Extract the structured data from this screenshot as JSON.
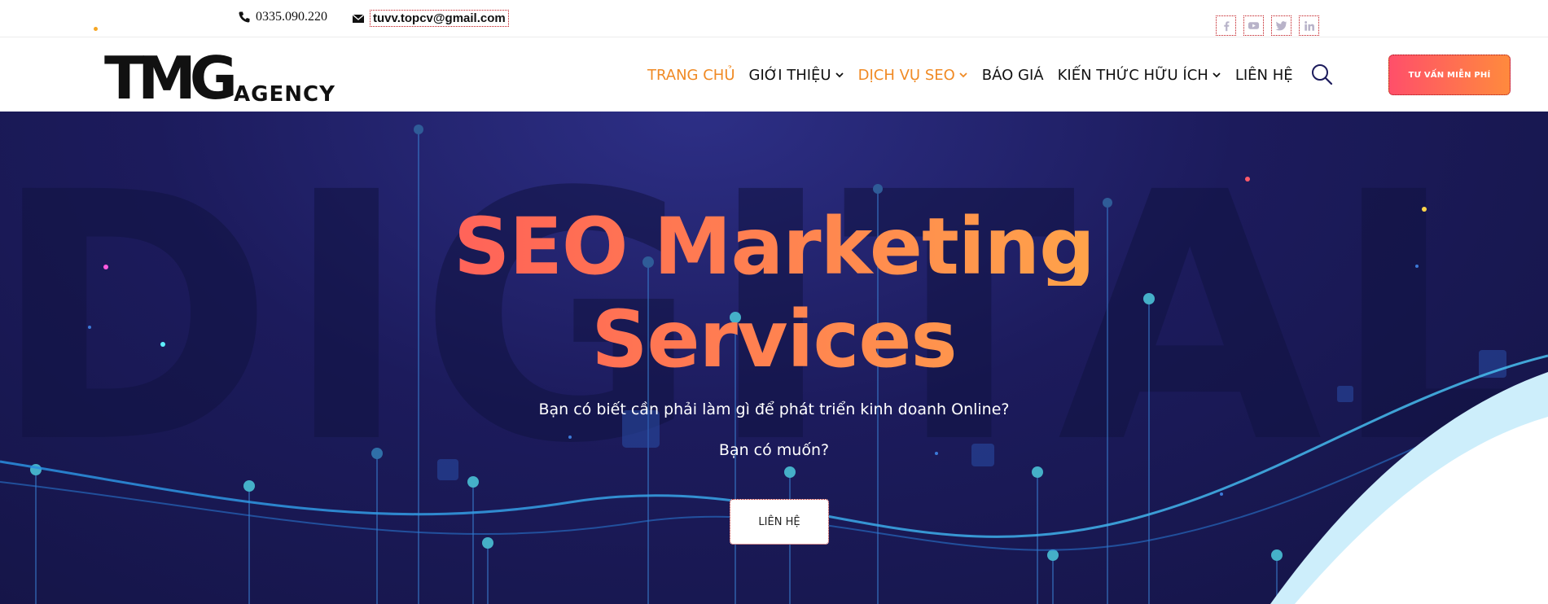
{
  "topbar": {
    "phone": "0335.090.220",
    "email": "tuvv.topcv@gmail.com",
    "social": [
      "facebook-icon",
      "youtube-icon",
      "twitter-icon",
      "linkedin-icon"
    ]
  },
  "header": {
    "logo_text": "TMG",
    "logo_sub": "AGENCY",
    "nav": [
      {
        "label": "TRANG CHỦ",
        "active": true,
        "dropdown": false
      },
      {
        "label": "GIỚI THIỆU",
        "active": false,
        "dropdown": true
      },
      {
        "label": "DỊCH VỤ SEO",
        "active": true,
        "dropdown": true
      },
      {
        "label": "BÁO GIÁ",
        "active": false,
        "dropdown": false
      },
      {
        "label": "KIẾN THỨC HỮU ÍCH",
        "active": false,
        "dropdown": true
      },
      {
        "label": "LIÊN HỆ",
        "active": false,
        "dropdown": false
      }
    ],
    "cta_label": "TƯ VẤN MIỄN PHÍ"
  },
  "hero": {
    "watermark": "DIGITAL",
    "title_line1": "SEO Marketing",
    "title_line2": "Services",
    "subtitle1": "Bạn có biết cần phải làm gì để phát triển kinh doanh Online?",
    "subtitle2": "Bạn có muốn?",
    "button_label": "LIÊN HỆ"
  },
  "colors": {
    "accent": "#f08a24",
    "cta_gradient_start": "#ff4f6a",
    "cta_gradient_end": "#ff8a3d",
    "hero_bg": "#1c1b5c"
  }
}
